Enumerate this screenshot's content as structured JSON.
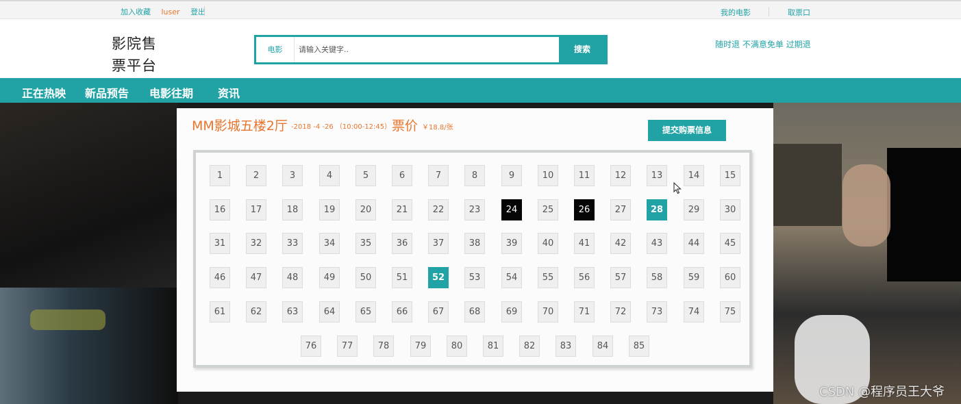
{
  "topbar": {
    "favorite": "加入收藏",
    "user": "luser",
    "logout": "登出",
    "my_movies": "我的电影",
    "ticket_pickup": "取票口"
  },
  "header": {
    "logo_line1": "影院售",
    "logo_line2": "票平台",
    "search_category": "电影",
    "search_placeholder": "请输入关键字..",
    "search_button": "搜索",
    "promo": "随时退 不满意免单 过期退"
  },
  "nav": {
    "items": [
      "正在热映",
      "新品预告",
      "电影往期",
      "资讯"
    ]
  },
  "booking": {
    "hall": "MM影城五楼2厅",
    "time": "-2018 -4 -26 （10:00-12:45）",
    "price_label": "票价",
    "price": "￥18.8/张",
    "submit_button": "提交购票信息",
    "sold_seats": [
      24,
      26
    ],
    "selected_seats": [
      28,
      52
    ],
    "rows": [
      [
        1,
        2,
        3,
        4,
        5,
        6,
        7,
        8,
        9,
        10,
        11,
        12,
        13,
        14,
        15
      ],
      [
        16,
        17,
        18,
        19,
        20,
        21,
        22,
        23,
        24,
        25,
        26,
        27,
        28,
        29,
        30
      ],
      [
        31,
        32,
        33,
        34,
        35,
        36,
        37,
        38,
        39,
        40,
        41,
        42,
        43,
        44,
        45
      ],
      [
        46,
        47,
        48,
        49,
        50,
        51,
        52,
        53,
        54,
        55,
        56,
        57,
        58,
        59,
        60
      ],
      [
        61,
        62,
        63,
        64,
        65,
        66,
        67,
        68,
        69,
        70,
        71,
        72,
        73,
        74,
        75
      ],
      [
        76,
        77,
        78,
        79,
        80,
        81,
        82,
        83,
        84,
        85
      ]
    ]
  },
  "watermark": "CSDN @程序员王大爷",
  "colors": {
    "accent": "#21a3a6",
    "orange": "#e8742b",
    "sold": "#050505"
  }
}
